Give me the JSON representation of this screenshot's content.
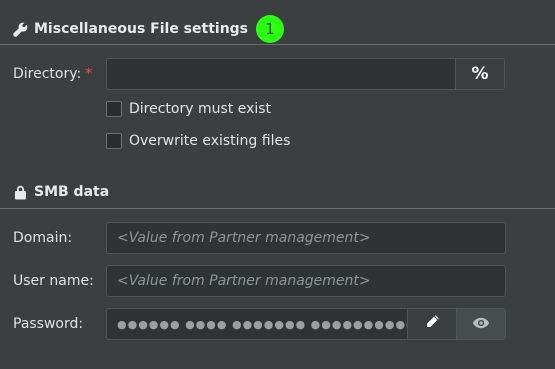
{
  "misc": {
    "title": "Miscellaneous File settings",
    "badge": "1",
    "directory_label": "Directory:",
    "required_mark": "*",
    "directory_value": "",
    "percent_button": "%",
    "must_exist_label": "Directory must exist",
    "overwrite_label": "Overwrite existing files"
  },
  "smb": {
    "title": "SMB data",
    "domain_label": "Domain:",
    "domain_placeholder": "<Value from Partner management>",
    "username_label": "User name:",
    "username_placeholder": "<Value from Partner management>",
    "password_label": "Password:",
    "password_mask": "●●●●●● ●●●● ●●●●●●● ●●●●●●●●●●●"
  },
  "colors": {
    "accent_badge": "#2bff12",
    "background": "#3b3f40",
    "required": "#e05a4a"
  },
  "icons": [
    "wrench-icon",
    "lock-icon",
    "pencil-icon",
    "eye-icon"
  ]
}
